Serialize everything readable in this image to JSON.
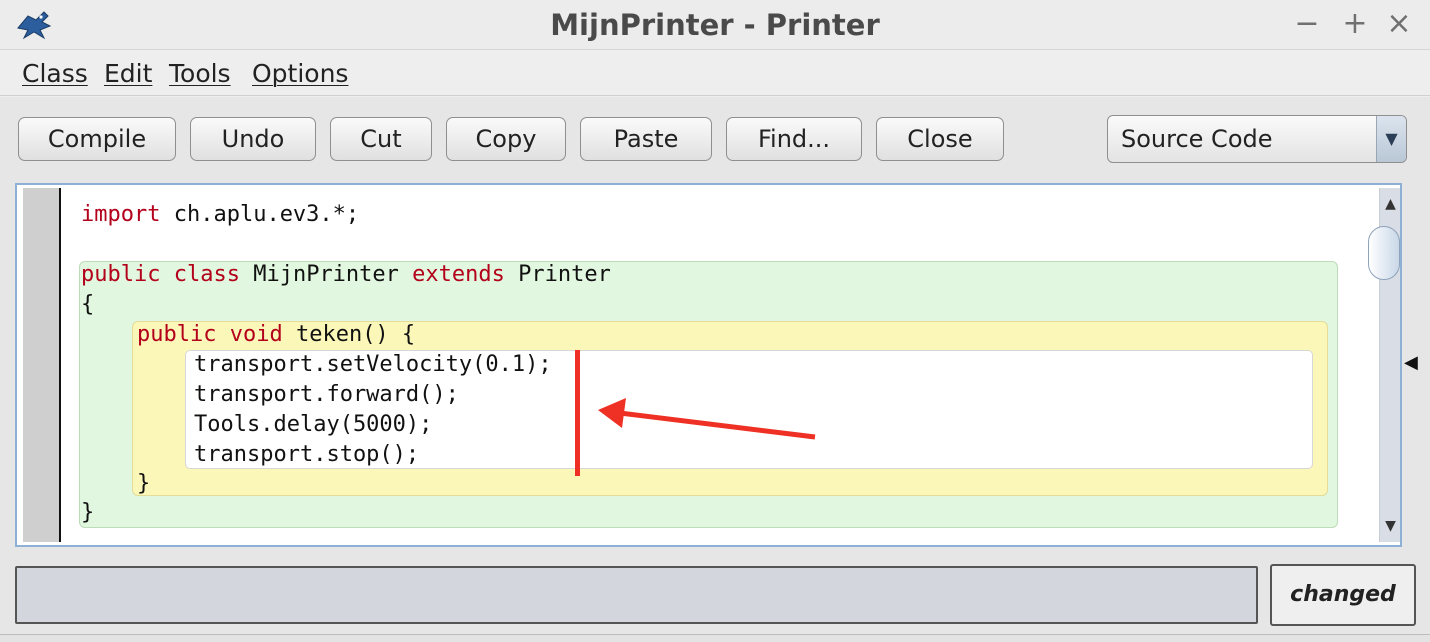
{
  "window": {
    "title": "MijnPrinter - Printer",
    "controls": {
      "minimize": "−",
      "maximize": "+",
      "close": "×"
    }
  },
  "menu": {
    "items": [
      "Class",
      "Edit",
      "Tools",
      "Options"
    ]
  },
  "toolbar": {
    "compile": "Compile",
    "undo": "Undo",
    "cut": "Cut",
    "copy": "Copy",
    "paste": "Paste",
    "find": "Find...",
    "close": "Close",
    "view_select": "Source Code"
  },
  "code": {
    "line1_kw": "import",
    "line1_rest": " ch.aplu.ev3.*;",
    "line2_kw1": "public",
    "line2_kw2": "class",
    "line2_name": " MijnPrinter ",
    "line2_kw3": "extends",
    "line2_rest": " Printer",
    "line3": "{",
    "line4_kw1": "public",
    "line4_kw2": "void",
    "line4_rest": " teken() {",
    "line5": "transport.setVelocity(0.1);",
    "line6": "transport.forward();",
    "line7": "Tools.delay(5000);",
    "line8": "transport.stop();",
    "line9": "}",
    "line10": "}"
  },
  "status": {
    "message": "",
    "state": "changed"
  },
  "colors": {
    "keyword": "#b3001b",
    "class_scope": "#e2f7df",
    "method_scope": "#fbf7b8",
    "annotation": "#ee3124"
  }
}
